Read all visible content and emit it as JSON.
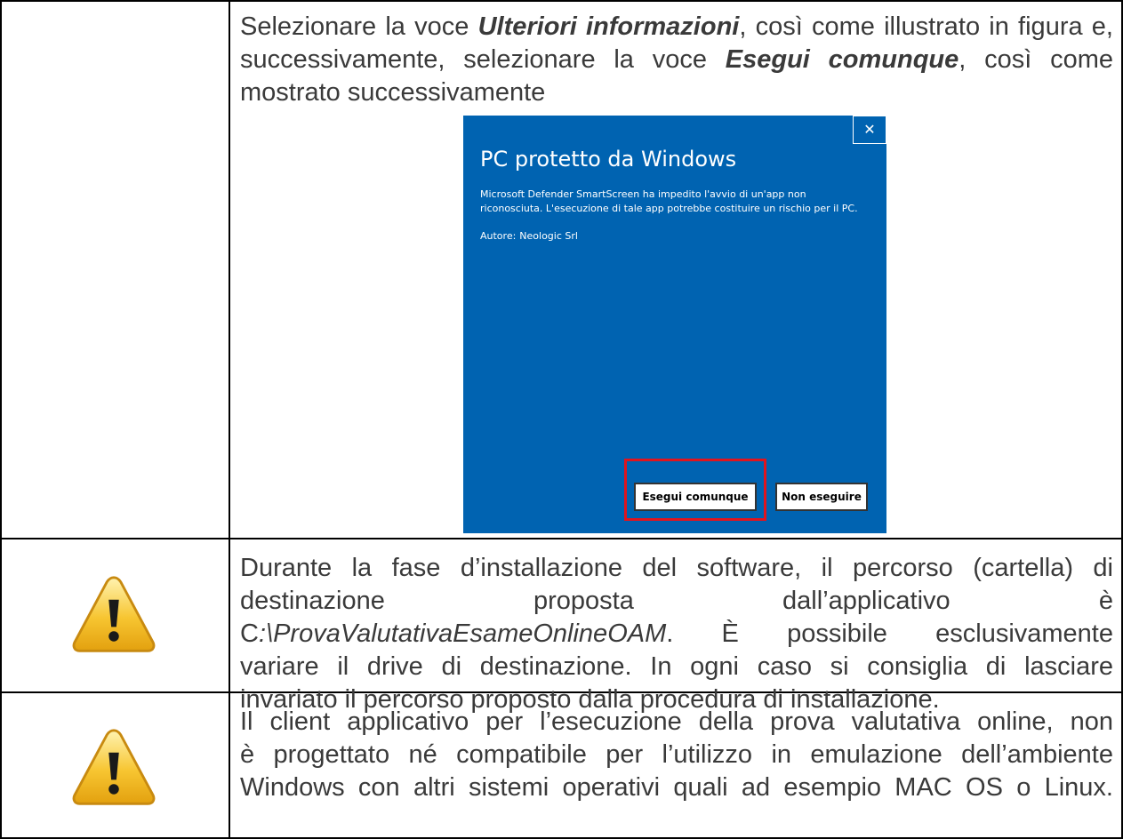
{
  "row1": {
    "text_a": "Selezionare la voce ",
    "em1": "Ulteriori informazioni",
    "text_b": ", così come illustrato in figura e, successivamente, selezionare la voce ",
    "em2": "Esegui comunque",
    "text_c": ", così come mostrato successivamente",
    "dialog": {
      "title": "PC protetto da Windows",
      "close_glyph": "✕",
      "message": "Microsoft Defender SmartScreen ha impedito l'avvio di un'app non riconosciuta. L'esecuzione di tale app potrebbe costituire un rischio per il PC.",
      "author_label": "Autore:",
      "author_value": "Neologic Srl",
      "run_button": "Esegui comunque",
      "dont_run_button": "Non eseguire",
      "background_color": "#0063b1",
      "highlight_color": "#e0141e"
    }
  },
  "row2": {
    "icon": "warning-icon",
    "line1": "Durante la fase d’installazione del software, il percorso (cartella) di",
    "line2": "destinazione proposta dall’applicativo è",
    "path_prefix": "C",
    "path_rest": ":\\ProvaValutativaEsameOnlineOAM",
    "line3_rest": ". È possibile esclusivamente",
    "line4": "variare il drive di destinazione. In ogni caso si consiglia di lasciare",
    "line5": "invariato il percorso proposto dalla procedura di installazione."
  },
  "row3": {
    "icon": "warning-icon",
    "line1": "Il client applicativo per l’esecuzione della prova valutativa online, non",
    "line2": "è progettato né compatibile per l’utilizzo in emulazione dell’ambiente",
    "line3": "Windows con altri sistemi operativi quali ad esempio MAC OS o Linux."
  }
}
